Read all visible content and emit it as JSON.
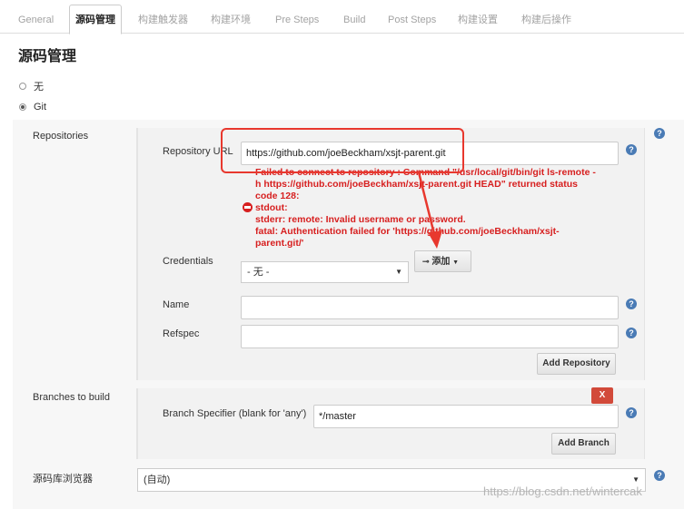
{
  "tabs": [
    {
      "label": "General"
    },
    {
      "label": "源码管理"
    },
    {
      "label": "构建触发器"
    },
    {
      "label": "构建环境"
    },
    {
      "label": "Pre Steps"
    },
    {
      "label": "Build"
    },
    {
      "label": "Post Steps"
    },
    {
      "label": "构建设置"
    },
    {
      "label": "构建后操作"
    }
  ],
  "section_title": "源码管理",
  "scm_options": [
    {
      "label": "无",
      "checked": false
    },
    {
      "label": "Git",
      "checked": true
    }
  ],
  "repositories": {
    "label": "Repositories",
    "url_label": "Repository URL",
    "url_value": "https://github.com/joeBeckham/xsjt-parent.git",
    "error_lines": [
      "Failed to connect to repository : Command \"/usr/local/git/bin/git ls-remote -",
      "h https://github.com/joeBeckham/xsjt-parent.git HEAD\" returned status",
      "code 128:",
      "stdout:",
      "stderr: remote: Invalid username or password.",
      "fatal: Authentication failed for 'https://github.com/joeBeckham/xsjt-",
      "parent.git/'"
    ],
    "credentials_label": "Credentials",
    "credentials_value": "- 无 -",
    "add_button": "添加",
    "name_label": "Name",
    "refspec_label": "Refspec",
    "add_repository_button": "Add Repository"
  },
  "branches": {
    "label": "Branches to build",
    "specifier_label": "Branch Specifier (blank for 'any')",
    "specifier_value": "*/master",
    "remove_button": "X",
    "add_branch_button": "Add Branch"
  },
  "browser": {
    "label": "源码库浏览器",
    "value": "(自动)"
  },
  "help_glyph": "?",
  "watermark": "https://blog.csdn.net/wintercak",
  "colors": {
    "error": "#d71f1f",
    "highlight": "#e8382e",
    "help": "#4a7bb5"
  }
}
